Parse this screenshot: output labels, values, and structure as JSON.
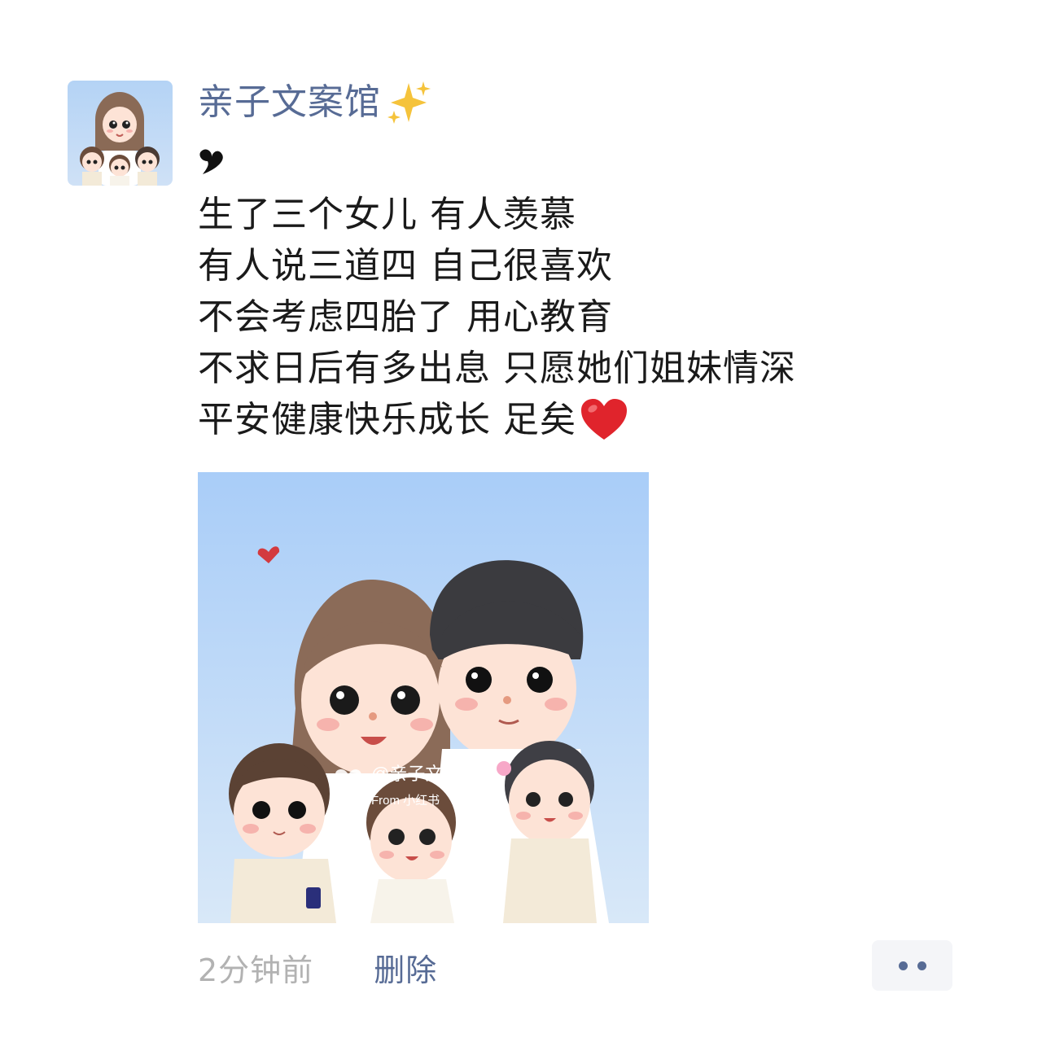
{
  "post": {
    "author_name": "亲子文案馆",
    "author_emoji_icon": "sparkles-icon",
    "bullet_icon": "black-heart-suit-icon",
    "lines": [
      "生了三个女儿 有人羡慕",
      "有人说三道四 自己很喜欢",
      "不会考虑四胎了 用心教育",
      "不求日后有多出息 只愿她们姐妹情深",
      "平安健康快乐成长 足矣"
    ],
    "trailing_emoji_icon": "red-heart-icon",
    "image": {
      "watermark_handle": "@亲子文案馆",
      "watermark_source": "From 小红书"
    },
    "timestamp": "2分钟前",
    "delete_label": "删除",
    "more_icon": "two-dots-icon"
  },
  "colors": {
    "link_blue": "#576b95",
    "text": "#1a1a1a",
    "meta_gray": "#b2b2b2",
    "more_bg": "#f4f5f8",
    "heart_red": "#e0242c"
  }
}
